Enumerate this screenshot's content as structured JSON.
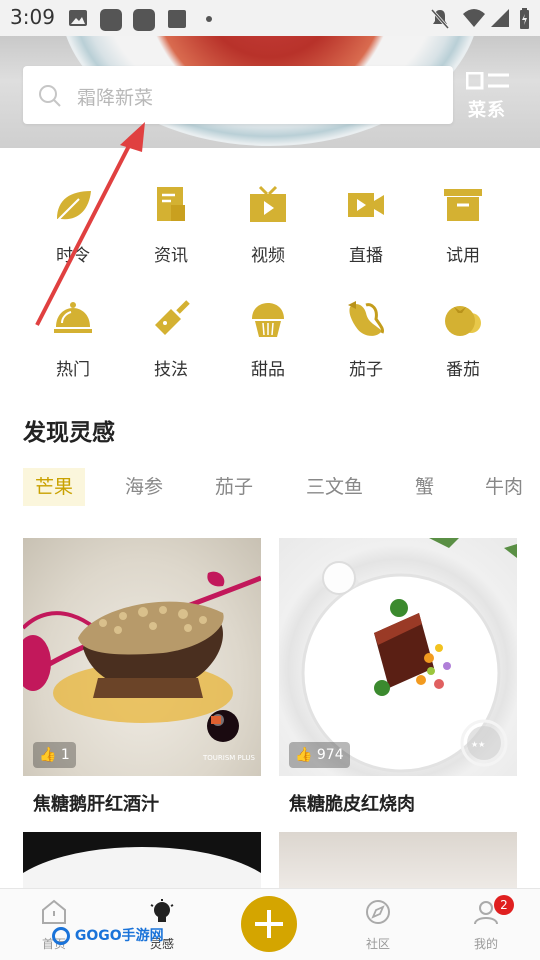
{
  "status_bar": {
    "time": "3:09"
  },
  "search": {
    "placeholder": "霜降新菜",
    "category_label": "菜系"
  },
  "grid": [
    {
      "label": "时令",
      "icon": "leaf-icon"
    },
    {
      "label": "资讯",
      "icon": "news-icon"
    },
    {
      "label": "视频",
      "icon": "tv-icon"
    },
    {
      "label": "直播",
      "icon": "video-camera-icon"
    },
    {
      "label": "试用",
      "icon": "box-icon"
    },
    {
      "label": "热门",
      "icon": "cloche-icon"
    },
    {
      "label": "技法",
      "icon": "cleaver-icon"
    },
    {
      "label": "甜品",
      "icon": "cupcake-icon"
    },
    {
      "label": "茄子",
      "icon": "eggplant-icon"
    },
    {
      "label": "番茄",
      "icon": "tomato-icon"
    }
  ],
  "section": {
    "title": "发现灵感"
  },
  "tabs": [
    "芒果",
    "海参",
    "茄子",
    "三文鱼",
    "蟹",
    "牛肉"
  ],
  "cards": [
    {
      "title": "焦糖鹅肝红酒汁",
      "likes": "1"
    },
    {
      "title": "焦糖脆皮红烧肉",
      "likes": "974"
    }
  ],
  "bottom_nav": [
    {
      "label": "首页",
      "icon": "home-icon"
    },
    {
      "label": "灵感",
      "icon": "lightbulb-icon"
    },
    {
      "label": "社区",
      "icon": "compass-icon"
    },
    {
      "label": "我的",
      "icon": "profile-icon"
    }
  ],
  "badge_count": "2",
  "watermark": "GOGO手游网",
  "colors": {
    "accent": "#d4a500",
    "icon_gold": "#d4b132",
    "badge": "#e02020",
    "annotation_arrow": "#e04040"
  }
}
